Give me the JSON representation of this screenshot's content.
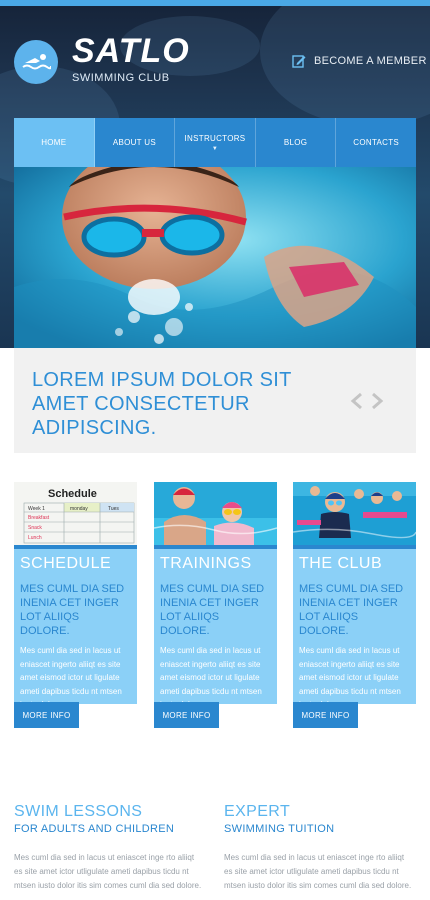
{
  "colors": {
    "accent": "#2a87cf",
    "accent_light": "#6cc0f3",
    "card_bg": "#8bd0f7",
    "heading_blue": "#2f8fd6"
  },
  "header": {
    "logo_title": "SATLO",
    "logo_subtitle": "SWIMMING CLUB",
    "logo_icon": "swimmer-icon",
    "member_label": "BECOME A MEMBER",
    "member_icon": "edit-icon"
  },
  "nav": {
    "items": [
      {
        "label": "HOME",
        "active": true
      },
      {
        "label": "ABOUT US"
      },
      {
        "label": "INSTRUCTORS",
        "has_dropdown": true
      },
      {
        "label": "BLOG"
      },
      {
        "label": "CONTACTS"
      }
    ]
  },
  "slider": {
    "caption": "LOREM IPSUM DOLOR SIT AMET CONSECTETUR ADIPISCING.",
    "prev_icon": "chevron-left-icon",
    "next_icon": "chevron-right-icon"
  },
  "cards": [
    {
      "title": "SCHEDULE",
      "subtitle": "MES CUML DIA SED INENIA CET INGER LOT ALIIQS DOLORE.",
      "body": "Mes cuml dia sed in lacus ut eniascet ingerto aliiqt es site amet eismod ictor ut ligulate ameti dapibus ticdu nt mtsen iusto dolor.",
      "button": "MORE INFO",
      "image_text": {
        "heading": "Schedule",
        "week": "Week 1",
        "day": "monday",
        "tues": "Tues",
        "row1": "Breakfast",
        "row2": "Snack",
        "row3": "Lunch"
      }
    },
    {
      "title": "TRAININGS",
      "subtitle": "MES CUML DIA SED INENIA CET INGER LOT ALIIQS DOLORE.",
      "body": "Mes cuml dia sed in lacus ut eniascet ingerto aliiqt es site amet eismod ictor ut ligulate ameti dapibus ticdu nt mtsen iusto dolor.",
      "button": "MORE INFO"
    },
    {
      "title": "THE CLUB",
      "subtitle": "MES CUML DIA SED INENIA CET INGER LOT ALIIQS DOLORE.",
      "body": "Mes cuml dia sed in lacus ut eniascet ingerto aliiqt es site amet eismod ictor ut ligulate ameti dapibus ticdu nt mtsen iusto dolor.",
      "button": "MORE INFO"
    }
  ],
  "bottom": {
    "left": {
      "title": "SWIM LESSONS",
      "subtitle": "FOR ADULTS AND CHILDREN",
      "body": "Mes cuml dia sed in lacus ut eniascet inge rto aliiqt es site amet ictor utligulate ameti dapibus ticdu nt mtsen iusto dolor itis sim comes cuml dia sed dolore."
    },
    "right": {
      "title": "EXPERT",
      "subtitle": "SWIMMING TUITION",
      "body": "Mes cuml dia sed in lacus ut eniascet inge rto aliiqt es site amet ictor utligulate ameti dapibus ticdu nt mtsen iusto dolor itis sim comes cuml dia sed dolore."
    }
  }
}
